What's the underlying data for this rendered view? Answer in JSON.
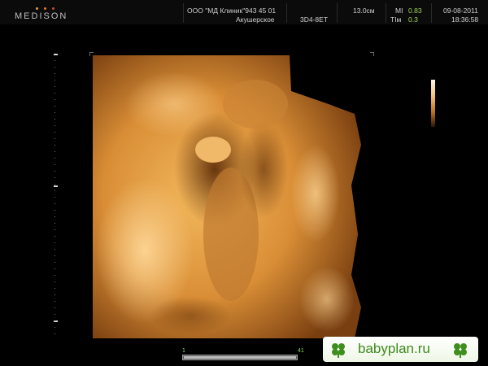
{
  "header": {
    "brand": "MEDISON",
    "brand_dot_colors": [
      "#d9a23a",
      "#e07a2a",
      "#c94a2a"
    ],
    "clinic": "ООО \"МД Клиник\"943 45 01",
    "department": "Акушерское",
    "probe": "3D4-8ET",
    "depth": "13.0см",
    "mi_label": "MI",
    "mi_value": "0.83",
    "tim_label": "TIм",
    "tim_value": "0.3",
    "date": "09-08-2011",
    "time": "18:36:58"
  },
  "slider": {
    "start": "1",
    "end": "41"
  },
  "watermark": {
    "text": "babyplan.ru"
  },
  "colors": {
    "accent_green": "#9fd45a",
    "tissue_amber": "#e8a049",
    "watermark_green": "#3c8a1c"
  }
}
